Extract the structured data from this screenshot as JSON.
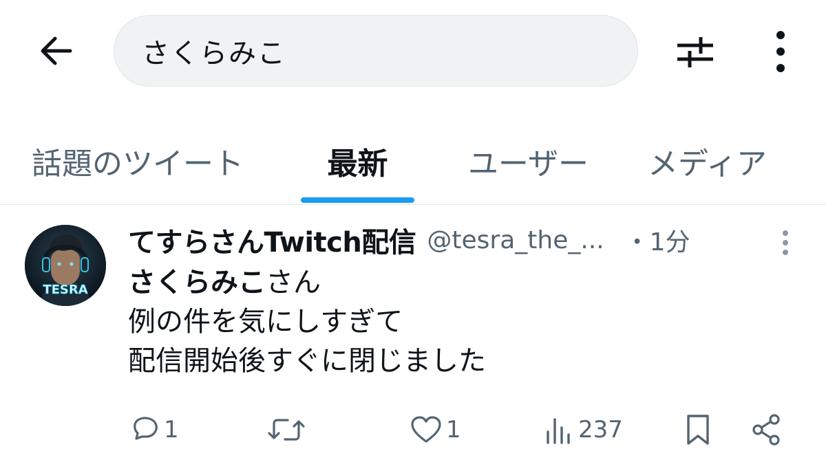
{
  "search": {
    "query": "さくらみこ"
  },
  "tabs": [
    {
      "label": "話題のツイート",
      "active": false
    },
    {
      "label": "最新",
      "active": true
    },
    {
      "label": "ユーザー",
      "active": false
    },
    {
      "label": "メディア",
      "active": false
    }
  ],
  "tweet": {
    "avatar_text": "TESRA",
    "display_name": "てすらさんTwitch配信",
    "handle": "@tesra_the_...",
    "timestamp": "・1分",
    "body": {
      "mention": "さくらみこ",
      "mention_suffix": "さん",
      "line2": "例の件を気にしすぎて",
      "line3": "配信開始後すぐに閉じました"
    },
    "actions": {
      "reply_count": "1",
      "like_count": "1",
      "view_count": "237"
    }
  },
  "colors": {
    "accent": "#1d9bf0",
    "text_primary": "#0f1419",
    "text_secondary": "#536471",
    "search_bg": "#eff3f4"
  },
  "icons": {
    "back": "arrow-left-icon",
    "filter": "sliders-icon",
    "more": "more-vertical-icon",
    "reply": "comment-icon",
    "retweet": "retweet-icon",
    "like": "heart-icon",
    "views": "bar-chart-icon",
    "bookmark": "bookmark-icon",
    "share": "share-icon"
  }
}
